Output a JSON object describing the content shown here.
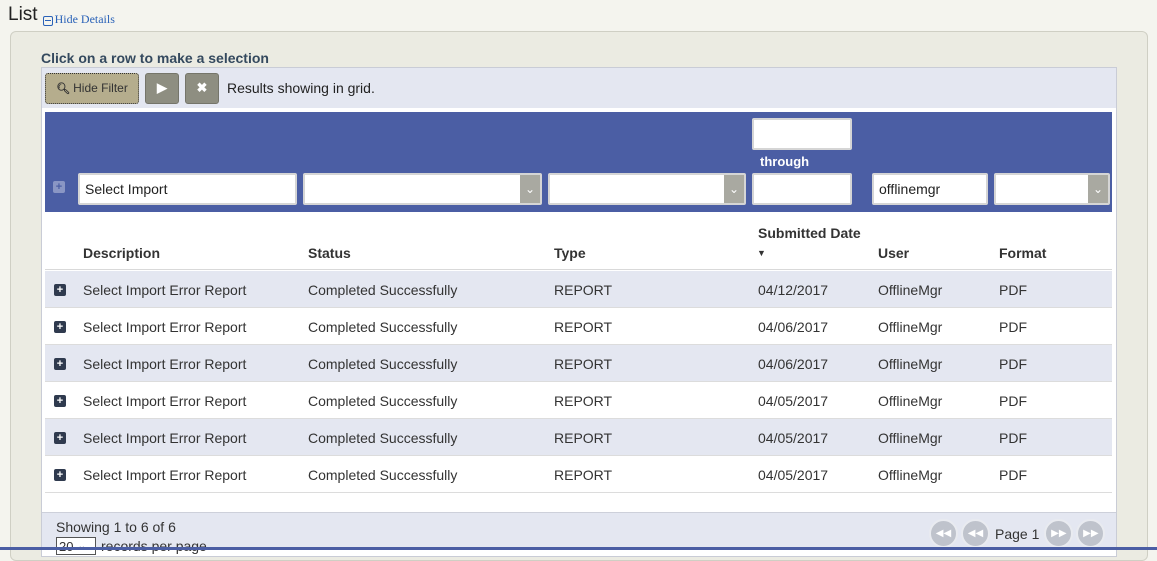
{
  "header": {
    "title": "List",
    "hide_details": "Hide Details"
  },
  "instruction": "Click on a row to make a selection",
  "toolbar": {
    "hide_filter": "Hide Filter",
    "run_icon": "play-icon",
    "clear_icon": "close-icon",
    "results_text": "Results showing in grid."
  },
  "filters": {
    "description": "Select Import",
    "status": "",
    "type": "",
    "date_from": "",
    "through_label": "through",
    "date_to": "",
    "user": "offlinemgr",
    "format": ""
  },
  "columns": {
    "description": "Description",
    "status": "Status",
    "type": "Type",
    "submitted_date": "Submitted Date",
    "user": "User",
    "format": "Format"
  },
  "rows": [
    {
      "description": "Select Import Error Report",
      "status": "Completed Successfully",
      "type": "REPORT",
      "date": "04/12/2017",
      "user": "OfflineMgr",
      "format": "PDF"
    },
    {
      "description": "Select Import Error Report",
      "status": "Completed Successfully",
      "type": "REPORT",
      "date": "04/06/2017",
      "user": "OfflineMgr",
      "format": "PDF"
    },
    {
      "description": "Select Import Error Report",
      "status": "Completed Successfully",
      "type": "REPORT",
      "date": "04/06/2017",
      "user": "OfflineMgr",
      "format": "PDF"
    },
    {
      "description": "Select Import Error Report",
      "status": "Completed Successfully",
      "type": "REPORT",
      "date": "04/05/2017",
      "user": "OfflineMgr",
      "format": "PDF"
    },
    {
      "description": "Select Import Error Report",
      "status": "Completed Successfully",
      "type": "REPORT",
      "date": "04/05/2017",
      "user": "OfflineMgr",
      "format": "PDF"
    },
    {
      "description": "Select Import Error Report",
      "status": "Completed Successfully",
      "type": "REPORT",
      "date": "04/05/2017",
      "user": "OfflineMgr",
      "format": "PDF"
    }
  ],
  "footer": {
    "showing": "Showing 1 to 6 of 6",
    "per_page_value": "20",
    "per_page_label": "records per page",
    "page_label": "Page 1"
  },
  "colors": {
    "filter_band": "#4b5ea4",
    "row_alt": "#e4e7f1",
    "link": "#2a62b8"
  }
}
